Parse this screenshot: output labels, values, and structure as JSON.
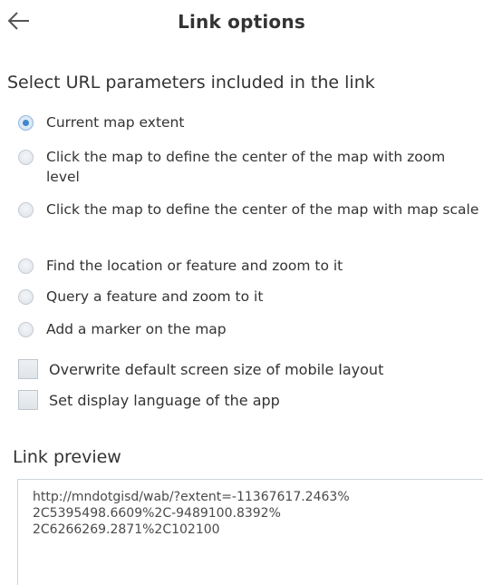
{
  "header": {
    "back_icon": "arrow-left-icon",
    "title": "Link options"
  },
  "params": {
    "heading": "Select URL parameters included in the link",
    "options": [
      {
        "label": "Current map extent",
        "selected": true
      },
      {
        "label": "Click the map to define the center of the map with zoom level",
        "selected": false
      },
      {
        "label": "Click the map to define the center of the map with map scale",
        "selected": false
      },
      {
        "label": "Find the location or feature and zoom to it",
        "selected": false
      },
      {
        "label": "Query a feature and zoom to it",
        "selected": false
      },
      {
        "label": "Add a marker on the map",
        "selected": false
      }
    ],
    "checkboxes": [
      {
        "label": "Overwrite default screen size of mobile layout",
        "checked": false
      },
      {
        "label": "Set display language of the app",
        "checked": false
      }
    ]
  },
  "preview": {
    "heading": "Link preview",
    "url": "http://mndotgisd/wab/?extent=-11367617.2463%\n2C5395498.6609%2C-9489100.8392%\n2C6266269.2871%2C102100"
  },
  "colors": {
    "accent": "#3f86cc",
    "text": "#333333",
    "border": "#cfd5da"
  }
}
